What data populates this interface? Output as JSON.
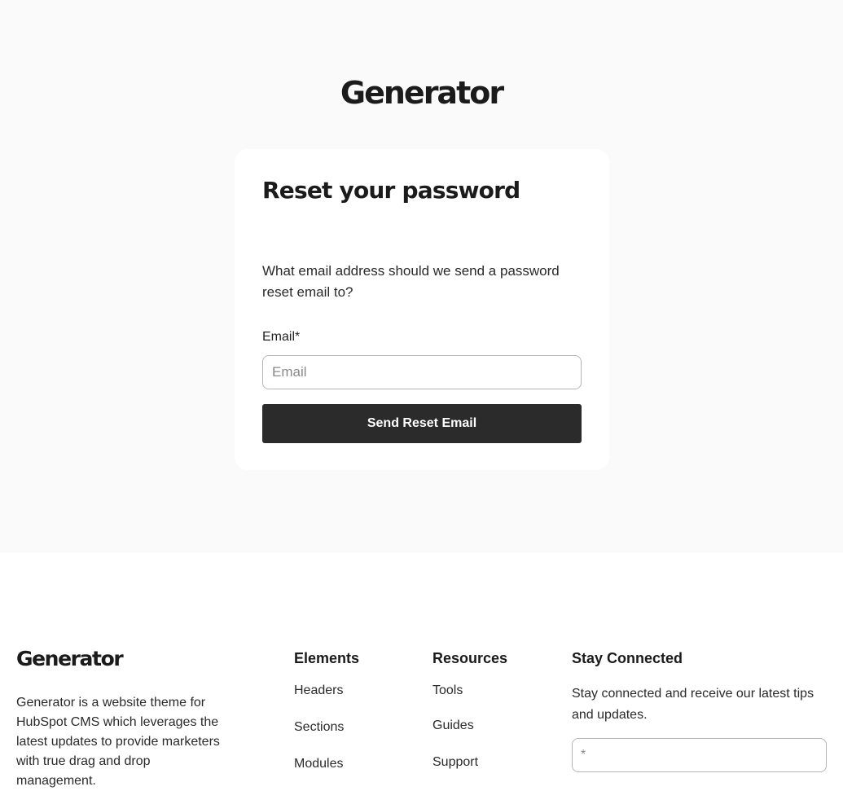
{
  "brand": {
    "name": "Generator"
  },
  "card": {
    "title": "Reset your password",
    "description": "What email address should we send a password reset email to?",
    "email_label": "Email*",
    "email_placeholder": "Email",
    "email_value": "",
    "submit_label": "Send Reset Email"
  },
  "footer": {
    "logo": "Generator",
    "about": "Generator is a website theme for HubSpot CMS which leverages the latest updates to provide marketers with true drag and drop management.",
    "columns": [
      {
        "title": "Elements",
        "links": [
          "Headers",
          "Sections",
          "Modules"
        ]
      },
      {
        "title": "Resources",
        "links": [
          "Tools",
          "Guides",
          "Support"
        ]
      }
    ],
    "stay_connected": {
      "title": "Stay Connected",
      "description": "Stay connected and receive our latest tips and updates.",
      "input_placeholder": "*"
    }
  }
}
